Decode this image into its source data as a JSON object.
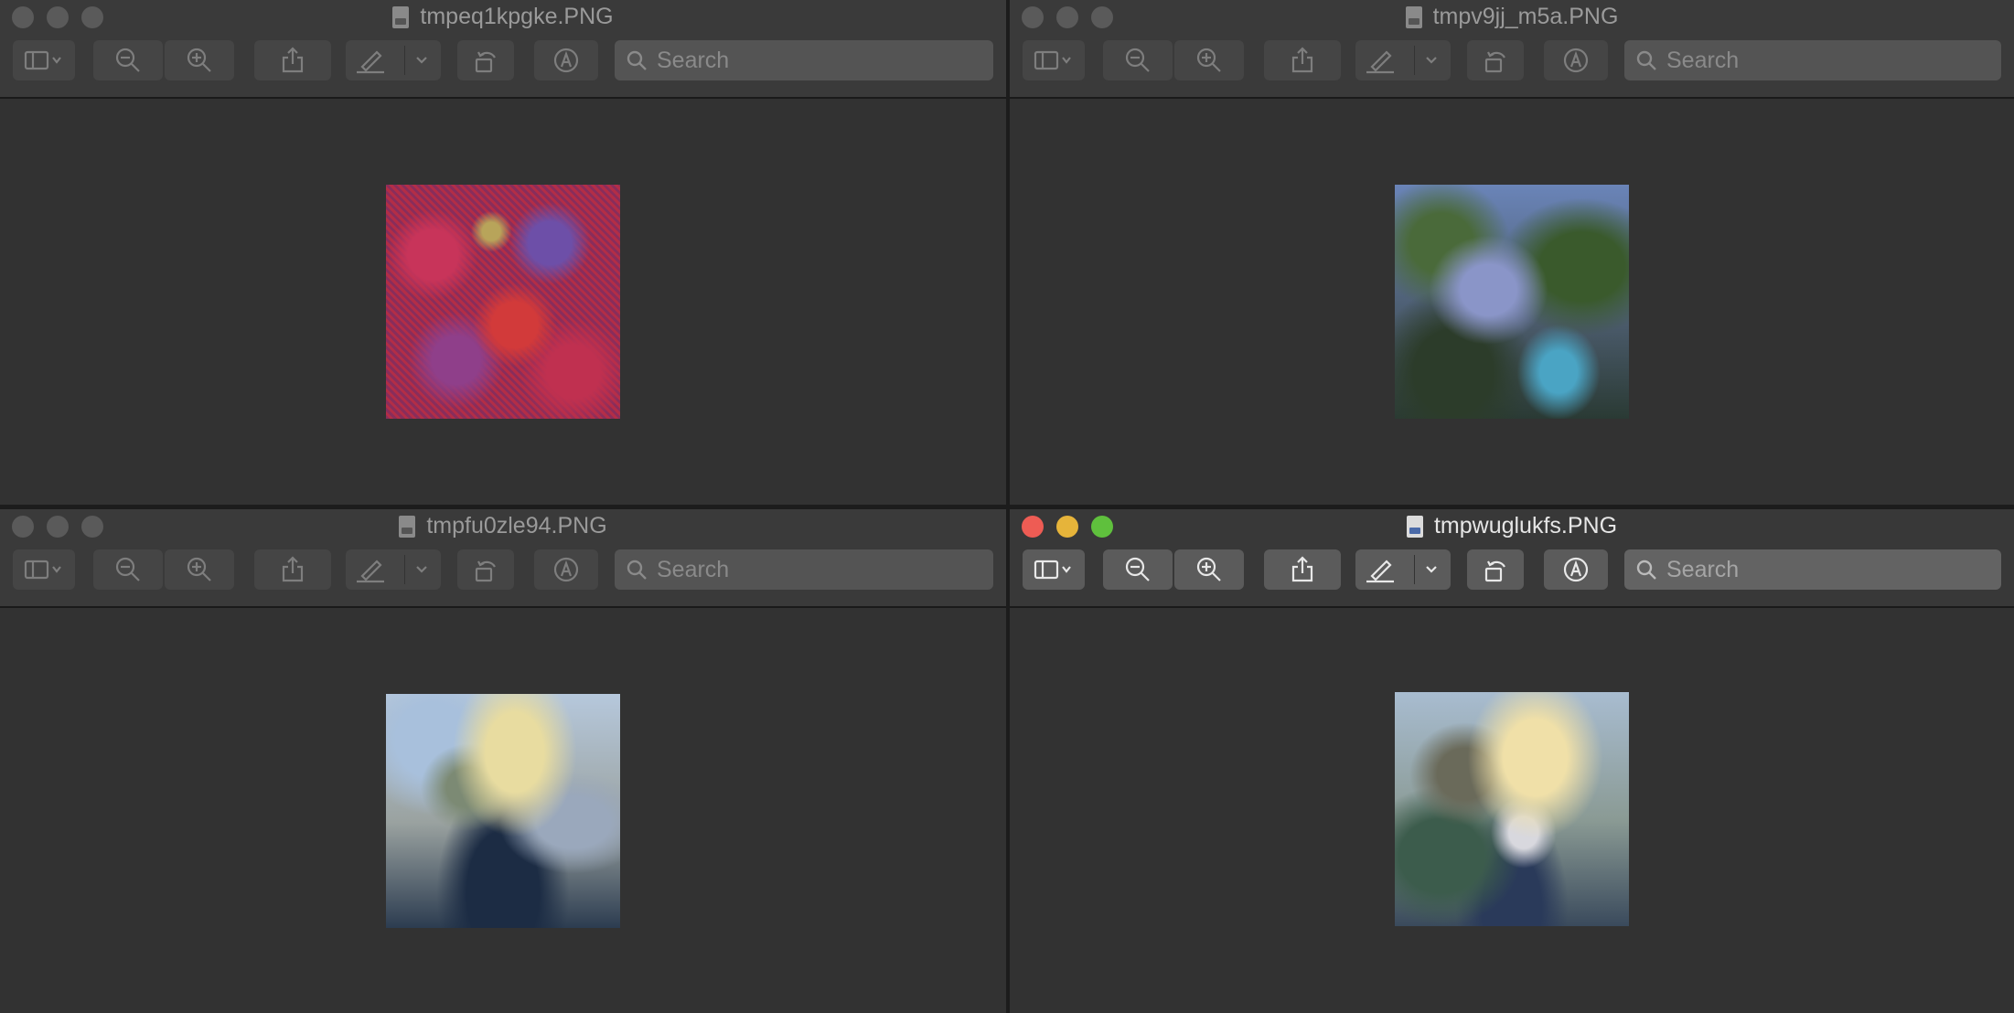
{
  "colors": {
    "close": "#ee5c54",
    "minimize": "#e6b43a",
    "zoom": "#5fc03d",
    "window_bg": "#323232"
  },
  "toolbar": {
    "search_placeholder": "Search",
    "icons": [
      "sidebar-icon",
      "chevron-down-icon",
      "zoom-out-icon",
      "zoom-in-icon",
      "share-icon",
      "markup-pen-icon",
      "rotate-icon",
      "annotate-icon",
      "search-icon"
    ]
  },
  "windows": [
    {
      "title": "tmpeq1kpgke.PNG",
      "active": false
    },
    {
      "title": "tmpv9jj_m5a.PNG",
      "active": false
    },
    {
      "title": "tmpfu0zle94.PNG",
      "active": false
    },
    {
      "title": "tmpwuglukfs.PNG",
      "active": true
    }
  ]
}
